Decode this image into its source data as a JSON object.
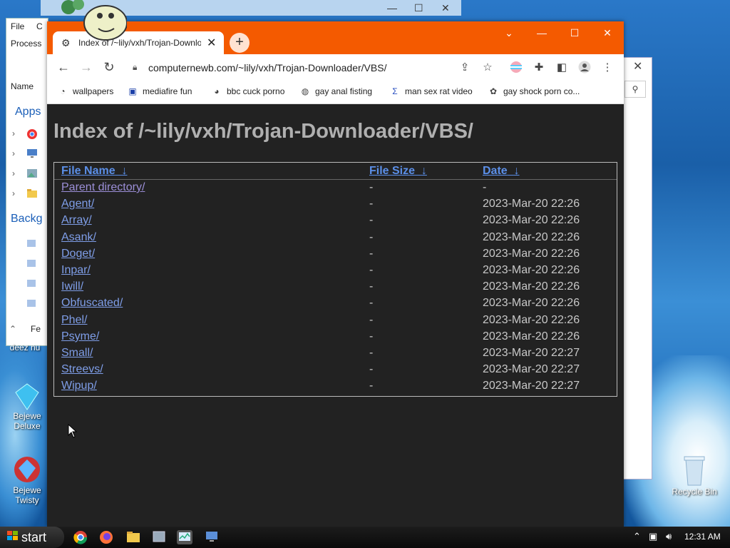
{
  "desktop": {
    "icons": [
      {
        "label": "deez nu",
        "name": "deez-nuts"
      },
      {
        "label": "Bejewe Deluxe",
        "name": "bejeweled-deluxe"
      },
      {
        "label": "Bejewe Twisty",
        "name": "bejeweled-twist"
      },
      {
        "label": "Recycle Bin",
        "name": "recycle-bin"
      }
    ]
  },
  "explorer": {
    "menu_file": "File",
    "menu_c": "C",
    "process": "Process",
    "name_col": "Name",
    "apps": "Apps",
    "backg": "Backg",
    "footer": "Fe"
  },
  "browser": {
    "tab": {
      "title": "Index of /~lily/vxh/Trojan-Downloader/VBS/",
      "close": "✕"
    },
    "newtab": "+",
    "url": "computernewb.com/~lily/vxh/Trojan-Downloader/VBS/",
    "bookmarks": [
      {
        "label": "wallpapers",
        "icon": "◔"
      },
      {
        "label": "mediafire fun",
        "icon": "▣"
      },
      {
        "label": "bbc cuck porno",
        "icon": "◕"
      },
      {
        "label": "gay anal fisting",
        "icon": "◍"
      },
      {
        "label": "man sex rat video",
        "icon": "Σ"
      },
      {
        "label": "gay shock porn co...",
        "icon": "✿"
      }
    ]
  },
  "page": {
    "title": "Index of /~lily/vxh/Trojan-Downloader/VBS/",
    "headers": {
      "name": "File Name",
      "size": "File Size",
      "date": "Date",
      "sort": "↓"
    },
    "rows": [
      {
        "name": "Parent directory/",
        "size": "-",
        "date": "-"
      },
      {
        "name": "Agent/",
        "size": "-",
        "date": "2023-Mar-20 22:26"
      },
      {
        "name": "Array/",
        "size": "-",
        "date": "2023-Mar-20 22:26"
      },
      {
        "name": "Asank/",
        "size": "-",
        "date": "2023-Mar-20 22:26"
      },
      {
        "name": "Doget/",
        "size": "-",
        "date": "2023-Mar-20 22:26"
      },
      {
        "name": "Inpar/",
        "size": "-",
        "date": "2023-Mar-20 22:26"
      },
      {
        "name": "Iwill/",
        "size": "-",
        "date": "2023-Mar-20 22:26"
      },
      {
        "name": "Obfuscated/",
        "size": "-",
        "date": "2023-Mar-20 22:26"
      },
      {
        "name": "Phel/",
        "size": "-",
        "date": "2023-Mar-20 22:26"
      },
      {
        "name": "Psyme/",
        "size": "-",
        "date": "2023-Mar-20 22:26"
      },
      {
        "name": "Small/",
        "size": "-",
        "date": "2023-Mar-20 22:27"
      },
      {
        "name": "Streevs/",
        "size": "-",
        "date": "2023-Mar-20 22:27"
      },
      {
        "name": "Wipup/",
        "size": "-",
        "date": "2023-Mar-20 22:27"
      }
    ]
  },
  "taskbar": {
    "start": "start",
    "clock": "12:31 AM"
  },
  "colors": {
    "tabstrip": "#f45a00",
    "page_bg": "#222222",
    "link": "#7f9ee8",
    "visited": "#9c8fd8",
    "title": "#b0b0b0"
  }
}
